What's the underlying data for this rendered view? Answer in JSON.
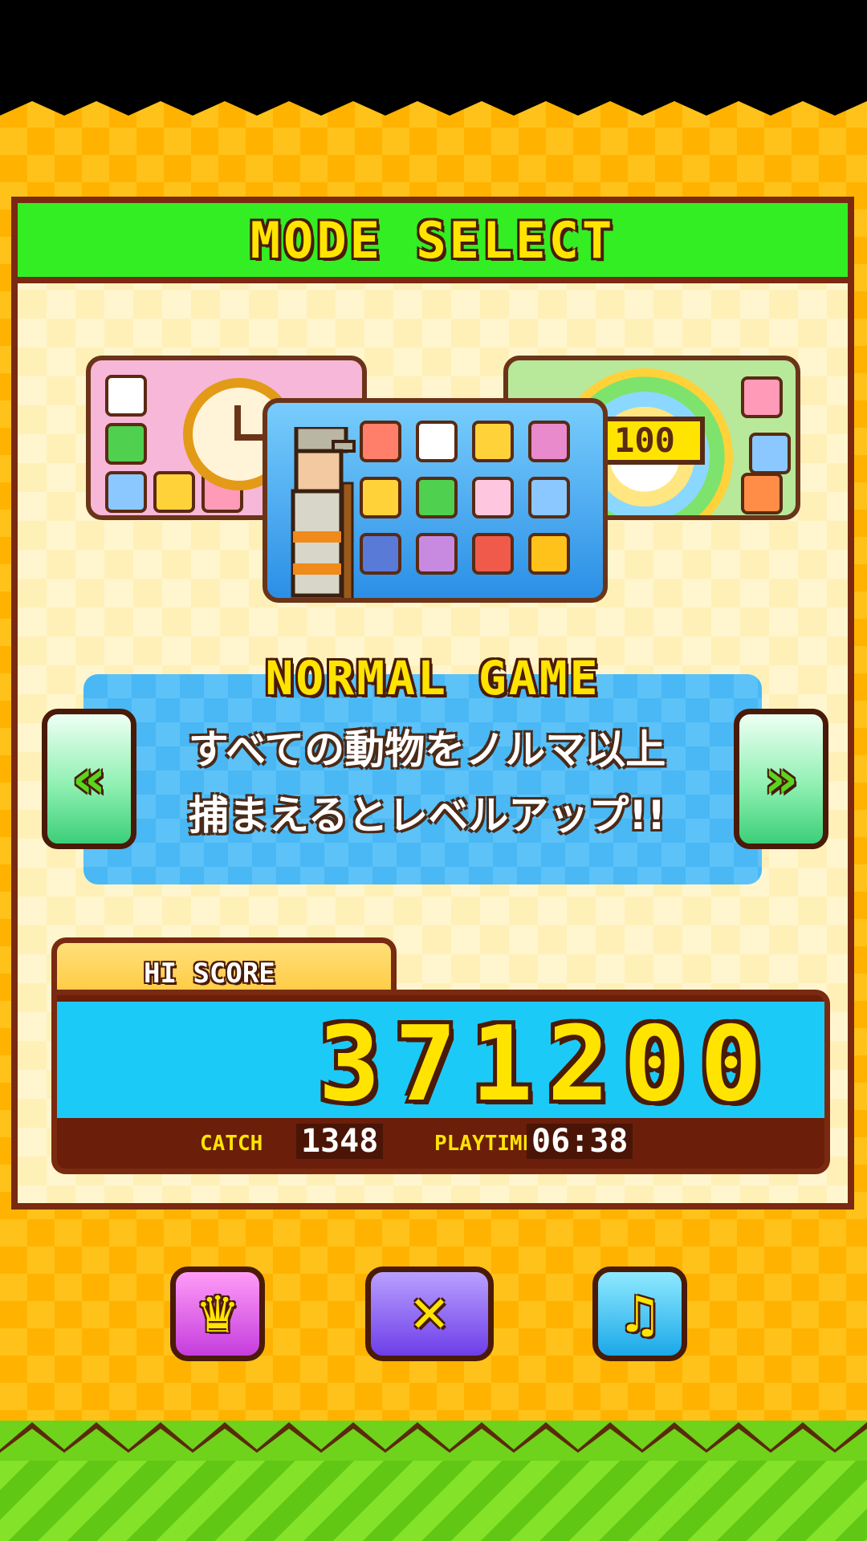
{
  "header": {
    "title": "MODE SELECT"
  },
  "modes": {
    "left_card_label": "timer-mode",
    "center_card_label": "normal-game",
    "right_card_label": "100",
    "current": {
      "name": "NORMAL GAME",
      "description_line1": "すべての動物をノルマ以上",
      "description_line2": "捕まえるとレベルアップ!!"
    }
  },
  "nav": {
    "prev": "«",
    "next": "»"
  },
  "hiscore": {
    "tab_label": "HI SCORE",
    "value": "371200",
    "catch_label": "CATCH",
    "catch_value": "1348",
    "playtime_label": "PLAYTIME",
    "playtime_value": "06:38"
  },
  "buttons": {
    "crown": "♛",
    "close": "✕",
    "music": "♫"
  },
  "colors": {
    "header_green": "#33ee22",
    "title_yellow": "#ffe400",
    "score_screen": "#1ccaf7",
    "border_brown": "#7a2a10"
  }
}
